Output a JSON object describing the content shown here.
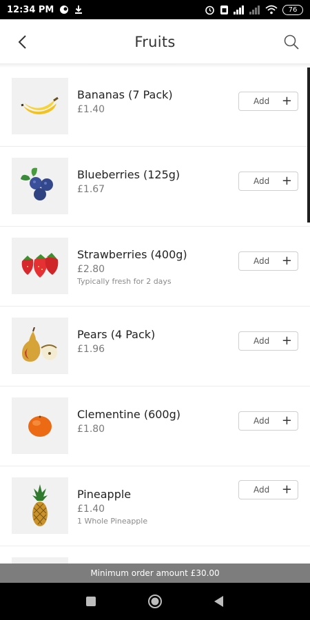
{
  "status_bar": {
    "time": "12:34 PM",
    "battery": "76"
  },
  "header": {
    "title": "Fruits"
  },
  "products": [
    {
      "name": "Bananas (7 Pack)",
      "price": "£1.40",
      "note": "",
      "image": "banana-image",
      "add_label": "Add"
    },
    {
      "name": "Blueberries (125g)",
      "price": "£1.67",
      "note": "",
      "image": "blueberries-image",
      "add_label": "Add"
    },
    {
      "name": "Strawberries (400g)",
      "price": "£2.80",
      "note": "Typically fresh for 2 days",
      "image": "strawberries-image",
      "add_label": "Add"
    },
    {
      "name": "Pears (4 Pack)",
      "price": "£1.96",
      "note": "",
      "image": "pears-image",
      "add_label": "Add"
    },
    {
      "name": "Clementine (600g)",
      "price": "£1.80",
      "note": "",
      "image": "clementine-image",
      "add_label": "Add"
    },
    {
      "name": "Pineapple",
      "price": "£1.40",
      "note": "1 Whole Pineapple",
      "image": "pineapple-image",
      "add_label": "Add"
    }
  ],
  "footer": {
    "min_order": "Minimum order amount £30.00"
  },
  "icons": {
    "back": "back-arrow-icon",
    "search": "search-icon",
    "add": "plus-icon"
  }
}
